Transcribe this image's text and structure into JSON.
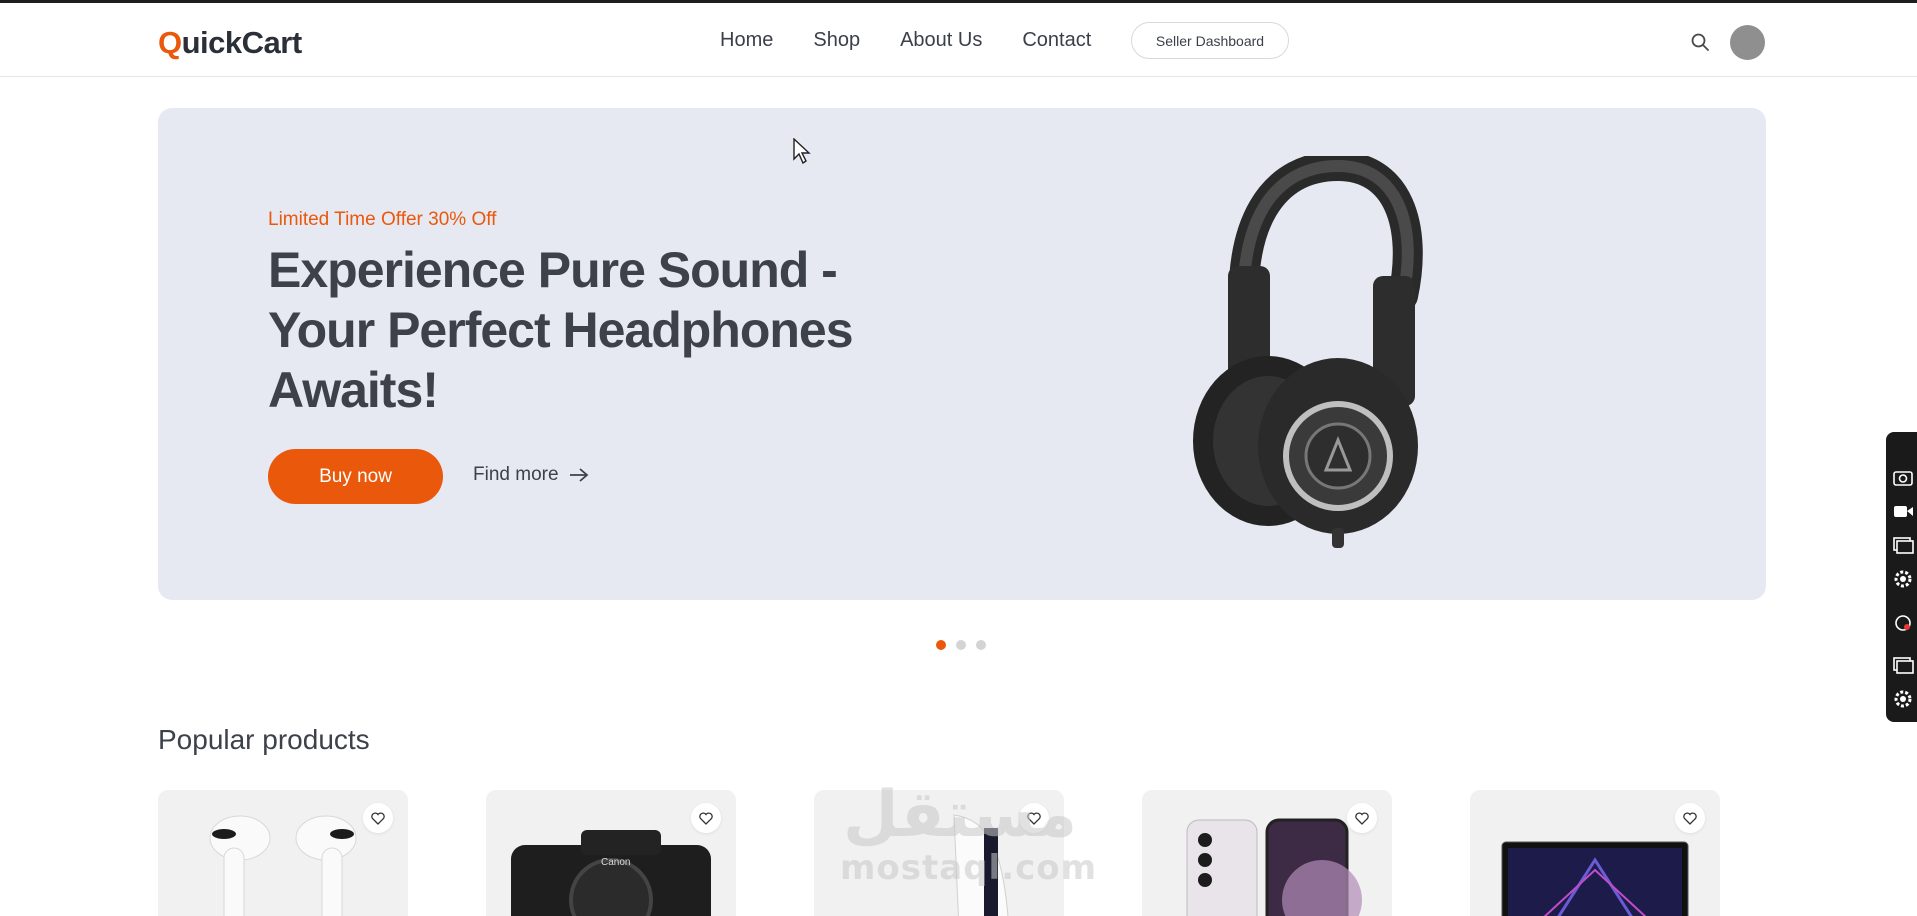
{
  "nav": {
    "logo_first": "Q",
    "logo_rest": "uickCart",
    "links": [
      "Home",
      "Shop",
      "About Us",
      "Contact"
    ],
    "seller_dashboard": "Seller Dashboard"
  },
  "hero": {
    "offer": "Limited Time Offer 30% Off",
    "title": "Experience Pure Sound - Your Perfect Headphones Awaits!",
    "buy_label": "Buy now",
    "find_more_label": "Find more",
    "slide_count": 3,
    "active_slide": 1
  },
  "popular": {
    "title": "Popular products"
  },
  "watermark": {
    "arabic": "مستقل",
    "latin": "mostaql.com"
  },
  "colors": {
    "accent": "#ea580c",
    "hero_bg": "#e6e9f2",
    "text": "#3d414a",
    "card_bg": "#f1f1f1"
  },
  "icons": [
    "search-icon",
    "avatar",
    "arrow-right-icon",
    "heart-icon",
    "camera-icon",
    "video-icon",
    "window-icon",
    "gear-icon",
    "mouse-pointer-icon"
  ]
}
